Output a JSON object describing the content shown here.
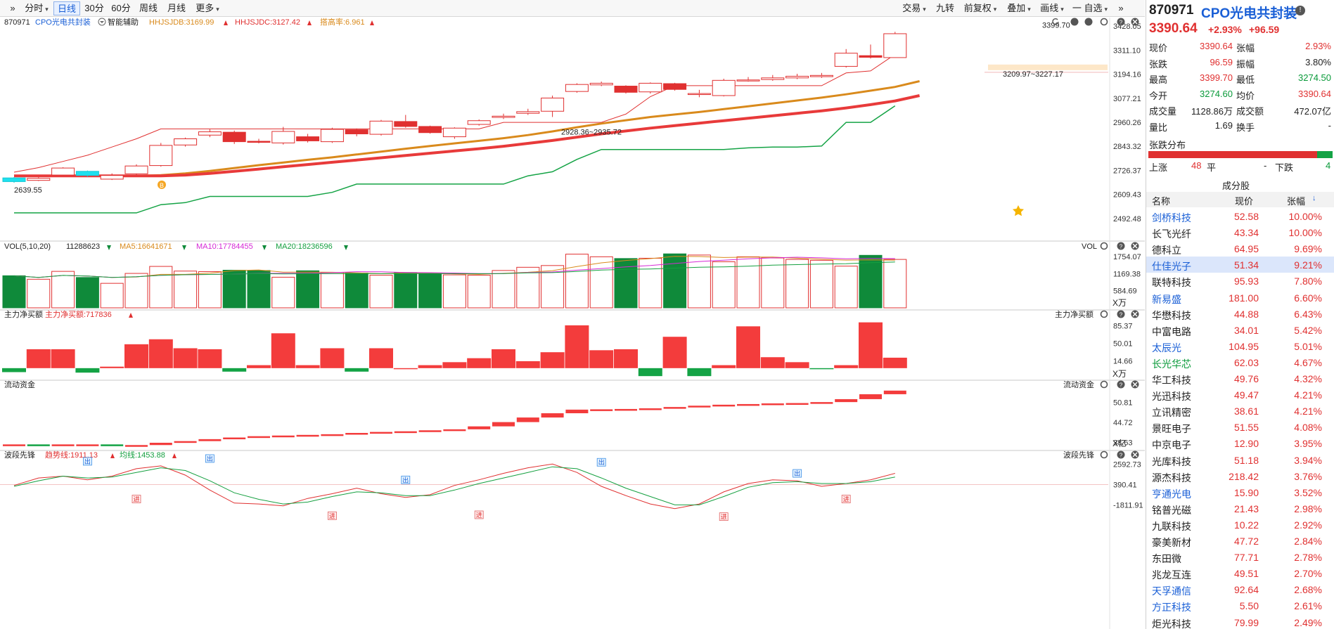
{
  "toolbar": {
    "left": [
      {
        "id": "collapse",
        "label": "»"
      },
      {
        "id": "fenshi",
        "label": "分时",
        "dropdown": true
      },
      {
        "id": "rixian",
        "label": "日线",
        "active": true
      },
      {
        "id": "m30",
        "label": "30分"
      },
      {
        "id": "m60",
        "label": "60分"
      },
      {
        "id": "zhouxian",
        "label": "周线"
      },
      {
        "id": "yuexian",
        "label": "月线"
      },
      {
        "id": "more",
        "label": "更多",
        "dropdown": true
      }
    ],
    "right": [
      {
        "id": "jiaoyi",
        "label": "交易",
        "dropdown": true
      },
      {
        "id": "jiuzhuan",
        "label": "九转"
      },
      {
        "id": "qianfuquan",
        "label": "前复权",
        "dropdown": true
      },
      {
        "id": "diejia",
        "label": "叠加",
        "dropdown": true
      },
      {
        "id": "huaxian",
        "label": "画线",
        "dropdown": true
      },
      {
        "id": "zixuan",
        "label": "一 自选",
        "dropdown": true
      },
      {
        "id": "expand",
        "label": "»"
      }
    ]
  },
  "main_panel": {
    "code": "870971",
    "name": "CPO光电共封装",
    "assist": "智能辅助",
    "ind1": "HHJSJDB:3169.99",
    "ind2": "HHJSJDC:3127.42",
    "ind3": "搭高率:6.961",
    "colors": {
      "ind1": "#d98a1c",
      "ind2": "#e03030",
      "ind3": "#d98a1c"
    },
    "y_labels": [
      "3428.05",
      "3311.10",
      "3194.16",
      "3077.21",
      "2960.26",
      "2843.32",
      "2726.37",
      "2609.43",
      "2492.48"
    ],
    "ann_high": "3399.70",
    "ann_mid": "3209.97~3227.17",
    "ann_gap": "2928.36~2935.72",
    "ann_low": "2639.55",
    "buy_marker": "B"
  },
  "vol_panel": {
    "title": "VOL(5,10,20)",
    "value": "11288623",
    "ma5": "MA5:16641671",
    "ma10": "MA10:17784455",
    "ma20": "MA20:18236596",
    "tag": "VOL",
    "y_labels": [
      "1754.07",
      "1169.38",
      "584.69"
    ],
    "unit": "X万"
  },
  "net_panel": {
    "title": "主力净买额",
    "value": "主力净买额:717836",
    "tag": "主力净买额",
    "y_labels": [
      "85.37",
      "50.01",
      "14.66"
    ],
    "unit": "X万"
  },
  "flow_panel": {
    "title": "流动资金",
    "tag": "流动资金",
    "y_labels": [
      "50.81",
      "44.72",
      "38.63"
    ],
    "unit": "X亿"
  },
  "wave_panel": {
    "title": "波段先锋",
    "trend": "趋势线:1911.13",
    "avg": "均线:1453.88",
    "tag": "波段先锋",
    "y_labels": [
      "2592.73",
      "390.41",
      "-1811.91"
    ],
    "out_label": "出",
    "in_label": "进"
  },
  "chart_data": {
    "type": "candlestick",
    "candles": [
      {
        "o": 2690,
        "c": 2672,
        "h": 2694,
        "l": 2666
      },
      {
        "o": 2678,
        "c": 2688,
        "h": 2693,
        "l": 2675
      },
      {
        "o": 2704,
        "c": 2738,
        "h": 2742,
        "l": 2700
      },
      {
        "o": 2722,
        "c": 2702,
        "h": 2726,
        "l": 2696
      },
      {
        "o": 2684,
        "c": 2702,
        "h": 2712,
        "l": 2680
      },
      {
        "o": 2710,
        "c": 2748,
        "h": 2756,
        "l": 2704
      },
      {
        "o": 2750,
        "c": 2848,
        "h": 2860,
        "l": 2745
      },
      {
        "o": 2850,
        "c": 2880,
        "h": 2886,
        "l": 2842
      },
      {
        "o": 2898,
        "c": 2914,
        "h": 2926,
        "l": 2888
      },
      {
        "o": 2912,
        "c": 2866,
        "h": 2920,
        "l": 2855
      },
      {
        "o": 2868,
        "c": 2866,
        "h": 2880,
        "l": 2858
      },
      {
        "o": 2860,
        "c": 2916,
        "h": 2938,
        "l": 2852
      },
      {
        "o": 2890,
        "c": 2870,
        "h": 2904,
        "l": 2862
      },
      {
        "o": 2866,
        "c": 2926,
        "h": 2934,
        "l": 2860
      },
      {
        "o": 2924,
        "c": 2904,
        "h": 2930,
        "l": 2892
      },
      {
        "o": 2902,
        "c": 2966,
        "h": 2972,
        "l": 2896
      },
      {
        "o": 2964,
        "c": 2940,
        "h": 2996,
        "l": 2934
      },
      {
        "o": 2940,
        "c": 2910,
        "h": 2944,
        "l": 2905
      },
      {
        "o": 2890,
        "c": 2932,
        "h": 2936,
        "l": 2880
      },
      {
        "o": 2950,
        "c": 2968,
        "h": 2974,
        "l": 2944
      },
      {
        "o": 2984,
        "c": 2990,
        "h": 3002,
        "l": 2976
      },
      {
        "o": 3004,
        "c": 3012,
        "h": 3026,
        "l": 2996
      },
      {
        "o": 3014,
        "c": 3078,
        "h": 3090,
        "l": 2986
      },
      {
        "o": 3110,
        "c": 3144,
        "h": 3150,
        "l": 3104
      },
      {
        "o": 3142,
        "c": 3150,
        "h": 3158,
        "l": 3136
      },
      {
        "o": 3136,
        "c": 3106,
        "h": 3140,
        "l": 3100
      },
      {
        "o": 3108,
        "c": 3150,
        "h": 3154,
        "l": 3100
      },
      {
        "o": 3148,
        "c": 3120,
        "h": 3152,
        "l": 3114
      },
      {
        "o": 3100,
        "c": 3100,
        "h": 3118,
        "l": 3082
      },
      {
        "o": 3090,
        "c": 3164,
        "h": 3172,
        "l": 3086
      },
      {
        "o": 3162,
        "c": 3166,
        "h": 3180,
        "l": 3158
      },
      {
        "o": 3168,
        "c": 3176,
        "h": 3190,
        "l": 3162
      },
      {
        "o": 3176,
        "c": 3184,
        "h": 3196,
        "l": 3170
      },
      {
        "o": 3182,
        "c": 3188,
        "h": 3200,
        "l": 3176
      },
      {
        "o": 3232,
        "c": 3296,
        "h": 3316,
        "l": 3226
      },
      {
        "o": 3284,
        "c": 3276,
        "h": 3338,
        "l": 3270
      },
      {
        "o": 3274.6,
        "c": 3390.64,
        "h": 3399.7,
        "l": 3274.5
      }
    ],
    "volume": [
      1100,
      980,
      1250,
      1040,
      840,
      1180,
      1420,
      1260,
      1240,
      1290,
      1280,
      1050,
      1270,
      1210,
      1190,
      1120,
      1210,
      1180,
      1130,
      1120,
      1280,
      1390,
      1450,
      1840,
      1750,
      1690,
      1700,
      1850,
      1810,
      1580,
      1750,
      1710,
      1660,
      1630,
      1430,
      1800,
      1660
    ],
    "net_buy": [
      -8,
      38,
      38,
      -9,
      3,
      48,
      58,
      40,
      38,
      -7,
      6,
      70,
      6,
      40,
      -7,
      40,
      0,
      6,
      12,
      20,
      38,
      14,
      32,
      86,
      36,
      38,
      -16,
      63,
      -16,
      6,
      84,
      22,
      12,
      -1,
      6,
      92,
      21,
      58
    ],
    "flow": [
      38.0,
      37.9,
      38.0,
      38.0,
      37.8,
      37.8,
      38.5,
      39.0,
      39.6,
      40.1,
      40.5,
      40.7,
      40.9,
      41.1,
      41.5,
      41.8,
      42.0,
      42.3,
      42.6,
      43.5,
      44.8,
      46.2,
      47.5,
      48.6,
      48.7,
      48.8,
      49.0,
      49.4,
      49.8,
      50.1,
      50.3,
      50.5,
      50.6,
      50.9,
      51.8,
      53.3,
      54.4
    ],
    "trend_line": [
      300,
      1100,
      1300,
      900,
      1300,
      2100,
      2400,
      1400,
      -200,
      -1600,
      -1700,
      -1900,
      -1100,
      -600,
      0,
      -600,
      -1000,
      -700,
      300,
      900,
      1600,
      2200,
      2600,
      1700,
      200,
      -800,
      -1700,
      -2200,
      -1700,
      -400,
      500,
      900,
      800,
      200,
      500,
      900,
      1600
    ],
    "avg_line": [
      200,
      800,
      1300,
      1100,
      1200,
      1700,
      2200,
      1900,
      800,
      -500,
      -1200,
      -1700,
      -1500,
      -900,
      -400,
      -500,
      -800,
      -800,
      -200,
      500,
      1100,
      1700,
      2300,
      2100,
      1100,
      0,
      -900,
      -1800,
      -1800,
      -900,
      100,
      600,
      700,
      500,
      500,
      700,
      1200
    ],
    "ma_orange": [
      2700,
      2700,
      2700,
      2700,
      2700,
      2700,
      2703,
      2712,
      2724,
      2738,
      2752,
      2765,
      2778,
      2790,
      2804,
      2818,
      2832,
      2845,
      2858,
      2870,
      2883,
      2898,
      2916,
      2936,
      2954,
      2970,
      2986,
      2998,
      3010,
      3024,
      3038,
      3052,
      3066,
      3080,
      3096,
      3114,
      3132,
      3160
    ],
    "ma_red": [
      2700,
      2700,
      2700,
      2700,
      2700,
      2700,
      2700,
      2704,
      2712,
      2722,
      2733,
      2744,
      2755,
      2766,
      2777,
      2788,
      2799,
      2810,
      2821,
      2832,
      2844,
      2858,
      2872,
      2888,
      2904,
      2918,
      2932,
      2944,
      2956,
      2968,
      2980,
      2992,
      3004,
      3016,
      3030,
      3046,
      3064,
      3090
    ],
    "upper_band": [
      2718,
      2740,
      2770,
      2800,
      2840,
      2880,
      2928,
      2928,
      2928,
      2928,
      2928,
      2928,
      2928,
      2928,
      2928,
      2928,
      2928,
      2928,
      2928,
      2928,
      2960,
      2960,
      2960,
      2960,
      2960,
      3000,
      3085,
      3138,
      3138,
      3138,
      3138,
      3138,
      3138,
      3138,
      3200,
      3210,
      3290
    ],
    "lower_band": [
      2520,
      2520,
      2520,
      2520,
      2520,
      2520,
      2560,
      2570,
      2600,
      2600,
      2600,
      2600,
      2600,
      2620,
      2660,
      2660,
      2660,
      2660,
      2660,
      2660,
      2660,
      2700,
      2720,
      2780,
      2828,
      2828,
      2828,
      2828,
      2828,
      2828,
      2836,
      2840,
      2840,
      2845,
      2960,
      2960,
      3040
    ]
  },
  "right_panel": {
    "code": "870971",
    "name": "CPO光电共封装",
    "info": "!",
    "price": "3390.64",
    "pct": "+2.93%",
    "chg": "+96.59",
    "quote": [
      {
        "l1": "现价",
        "v1": "3390.64",
        "c1": "red",
        "l2": "张幅",
        "v2": "2.93%",
        "c2": "red"
      },
      {
        "l1": "张跌",
        "v1": "96.59",
        "c1": "red",
        "l2": "振幅",
        "v2": "3.80%",
        "c2": "dark"
      },
      {
        "l1": "最高",
        "v1": "3399.70",
        "c1": "red",
        "l2": "最低",
        "v2": "3274.50",
        "c2": "green"
      },
      {
        "l1": "今开",
        "v1": "3274.60",
        "c1": "green",
        "l2": "均价",
        "v2": "3390.64",
        "c2": "red"
      },
      {
        "l1": "成交量",
        "v1": "1128.86万",
        "c1": "dark",
        "l2": "成交额",
        "v2": "472.07亿",
        "c2": "dark"
      },
      {
        "l1": "量比",
        "v1": "1.69",
        "c1": "dark",
        "l2": "换手",
        "v2": "-",
        "c2": "dark"
      }
    ],
    "dist_title": "张跌分布",
    "dist": {
      "up_label": "上涨",
      "up": "48",
      "flat_label": "平",
      "flat": "-",
      "down_label": "下跌",
      "down": "4"
    },
    "comp_title": "成分股",
    "cols": {
      "name": "名称",
      "price": "现价",
      "pct": "张幅"
    },
    "stocks": [
      {
        "name": "剑桥科技",
        "price": "52.58",
        "pct": "10.00%",
        "link": true
      },
      {
        "name": "长飞光纤",
        "price": "43.34",
        "pct": "10.00%"
      },
      {
        "name": "德科立",
        "price": "64.95",
        "pct": "9.69%"
      },
      {
        "name": "仕佳光子",
        "price": "51.34",
        "pct": "9.21%",
        "link": true,
        "hl": true
      },
      {
        "name": "联特科技",
        "price": "95.93",
        "pct": "7.80%"
      },
      {
        "name": "新易盛",
        "price": "181.00",
        "pct": "6.60%",
        "link": true
      },
      {
        "name": "华懋科技",
        "price": "44.88",
        "pct": "6.43%"
      },
      {
        "name": "中富电路",
        "price": "34.01",
        "pct": "5.42%"
      },
      {
        "name": "太辰光",
        "price": "104.95",
        "pct": "5.01%",
        "link": true
      },
      {
        "name": "长光华芯",
        "price": "62.03",
        "pct": "4.67%",
        "green": true
      },
      {
        "name": "华工科技",
        "price": "49.76",
        "pct": "4.32%"
      },
      {
        "name": "光迅科技",
        "price": "49.47",
        "pct": "4.21%"
      },
      {
        "name": "立讯精密",
        "price": "38.61",
        "pct": "4.21%"
      },
      {
        "name": "景旺电子",
        "price": "51.55",
        "pct": "4.08%"
      },
      {
        "name": "中京电子",
        "price": "12.90",
        "pct": "3.95%"
      },
      {
        "name": "光库科技",
        "price": "51.18",
        "pct": "3.94%"
      },
      {
        "name": "源杰科技",
        "price": "218.42",
        "pct": "3.76%"
      },
      {
        "name": "亨通光电",
        "price": "15.90",
        "pct": "3.52%",
        "link": true
      },
      {
        "name": "铭普光磁",
        "price": "21.43",
        "pct": "2.98%"
      },
      {
        "name": "九联科技",
        "price": "10.22",
        "pct": "2.92%"
      },
      {
        "name": "豪美新材",
        "price": "47.72",
        "pct": "2.84%"
      },
      {
        "name": "东田微",
        "price": "77.71",
        "pct": "2.78%"
      },
      {
        "name": "兆龙互连",
        "price": "49.51",
        "pct": "2.70%"
      },
      {
        "name": "天孚通信",
        "price": "92.64",
        "pct": "2.68%",
        "link": true
      },
      {
        "name": "方正科技",
        "price": "5.50",
        "pct": "2.61%",
        "link": true
      },
      {
        "name": "炬光科技",
        "price": "79.99",
        "pct": "2.49%"
      }
    ]
  }
}
